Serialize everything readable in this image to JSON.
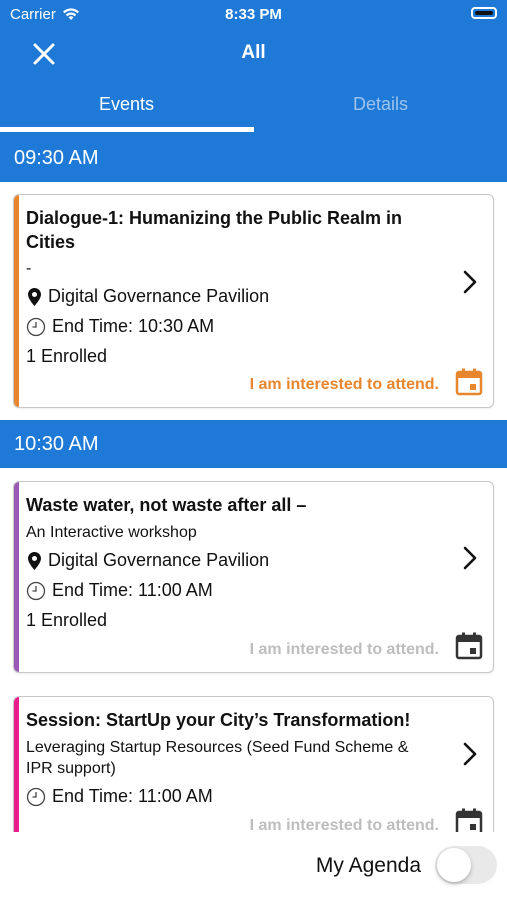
{
  "status_bar": {
    "carrier": "Carrier",
    "time": "8:33 PM"
  },
  "nav": {
    "title": "All",
    "close_icon": "close-icon"
  },
  "tabs": [
    {
      "label": "Events",
      "active": true
    },
    {
      "label": "Details",
      "active": false
    }
  ],
  "sections": [
    {
      "time": "09:30 AM",
      "events": [
        {
          "title": "Dialogue-1: Humanizing the Public Realm in Cities",
          "subtitle": "-",
          "location": "Digital Governance Pavilion",
          "end_time": "End Time: 10:30 AM",
          "enrolled": "1 Enrolled",
          "interest_label": "I am interested to attend.",
          "interested": true,
          "accent_color": "#e8862e"
        }
      ]
    },
    {
      "time": "10:30 AM",
      "events": [
        {
          "title": "Waste water, not waste after all –",
          "subtitle": "An Interactive workshop",
          "location": "Digital Governance Pavilion",
          "end_time": "End Time: 11:00 AM",
          "enrolled": "1 Enrolled",
          "interest_label": "I am interested to attend.",
          "interested": false,
          "accent_color": "#9b59b6"
        },
        {
          "title": "Session: StartUp your City’s Transformation!",
          "subtitle": "Leveraging Startup Resources (Seed Fund Scheme & IPR support)",
          "end_time": "End Time: 11:00 AM",
          "interest_label": "I am interested to attend.",
          "interested": false,
          "accent_color": "#e91e8c"
        }
      ]
    }
  ],
  "footer": {
    "my_agenda_label": "My Agenda",
    "my_agenda_enabled": false
  },
  "colors": {
    "primary": "#1e7ad6",
    "interested": "#e8862e",
    "inactive": "#bdbdbd"
  }
}
